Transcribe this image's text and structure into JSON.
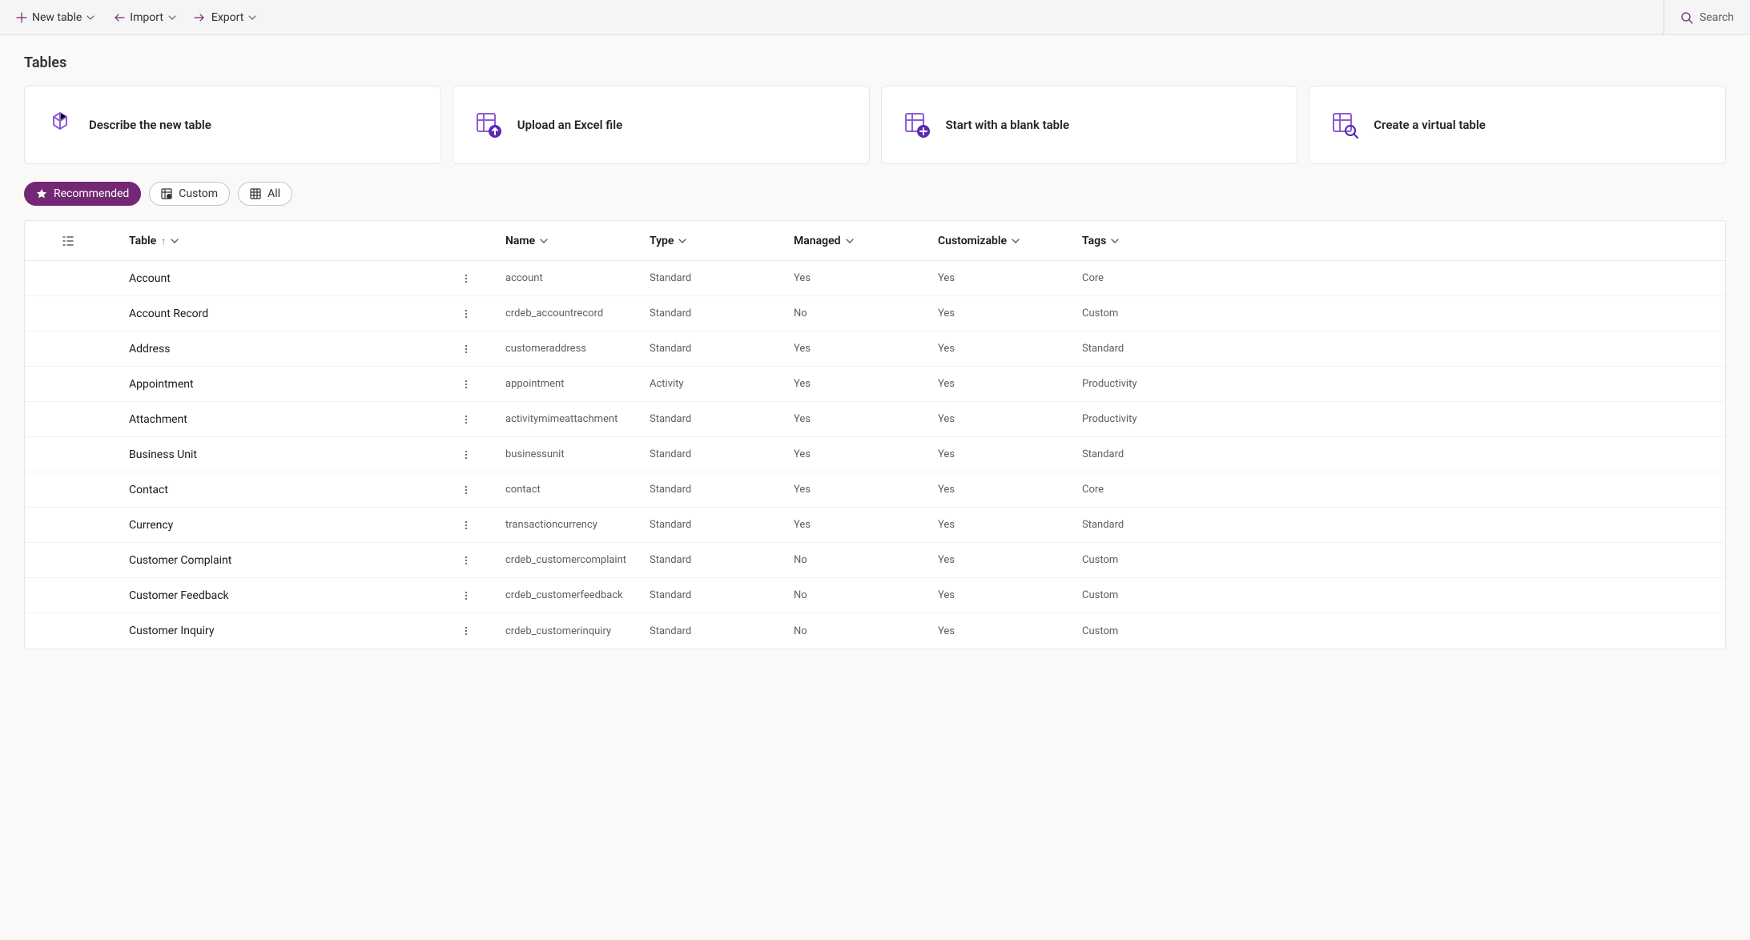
{
  "toolbar": {
    "new_table": "New table",
    "import": "Import",
    "export": "Export",
    "search_placeholder": "Search"
  },
  "page_title": "Tables",
  "cards": {
    "describe": "Describe the new table",
    "upload": "Upload an Excel file",
    "blank": "Start with a blank table",
    "virtual": "Create a virtual table"
  },
  "filters": {
    "recommended": "Recommended",
    "custom": "Custom",
    "all": "All"
  },
  "columns": {
    "table": "Table",
    "name": "Name",
    "type": "Type",
    "managed": "Managed",
    "customizable": "Customizable",
    "tags": "Tags"
  },
  "rows": [
    {
      "table": "Account",
      "name": "account",
      "type": "Standard",
      "managed": "Yes",
      "customizable": "Yes",
      "tags": "Core"
    },
    {
      "table": "Account Record",
      "name": "crdeb_accountrecord",
      "type": "Standard",
      "managed": "No",
      "customizable": "Yes",
      "tags": "Custom"
    },
    {
      "table": "Address",
      "name": "customeraddress",
      "type": "Standard",
      "managed": "Yes",
      "customizable": "Yes",
      "tags": "Standard"
    },
    {
      "table": "Appointment",
      "name": "appointment",
      "type": "Activity",
      "managed": "Yes",
      "customizable": "Yes",
      "tags": "Productivity"
    },
    {
      "table": "Attachment",
      "name": "activitymimeattachment",
      "type": "Standard",
      "managed": "Yes",
      "customizable": "Yes",
      "tags": "Productivity"
    },
    {
      "table": "Business Unit",
      "name": "businessunit",
      "type": "Standard",
      "managed": "Yes",
      "customizable": "Yes",
      "tags": "Standard"
    },
    {
      "table": "Contact",
      "name": "contact",
      "type": "Standard",
      "managed": "Yes",
      "customizable": "Yes",
      "tags": "Core"
    },
    {
      "table": "Currency",
      "name": "transactioncurrency",
      "type": "Standard",
      "managed": "Yes",
      "customizable": "Yes",
      "tags": "Standard"
    },
    {
      "table": "Customer Complaint",
      "name": "crdeb_customercomplaint",
      "type": "Standard",
      "managed": "No",
      "customizable": "Yes",
      "tags": "Custom"
    },
    {
      "table": "Customer Feedback",
      "name": "crdeb_customerfeedback",
      "type": "Standard",
      "managed": "No",
      "customizable": "Yes",
      "tags": "Custom"
    },
    {
      "table": "Customer Inquiry",
      "name": "crdeb_customerinquiry",
      "type": "Standard",
      "managed": "No",
      "customizable": "Yes",
      "tags": "Custom"
    }
  ]
}
